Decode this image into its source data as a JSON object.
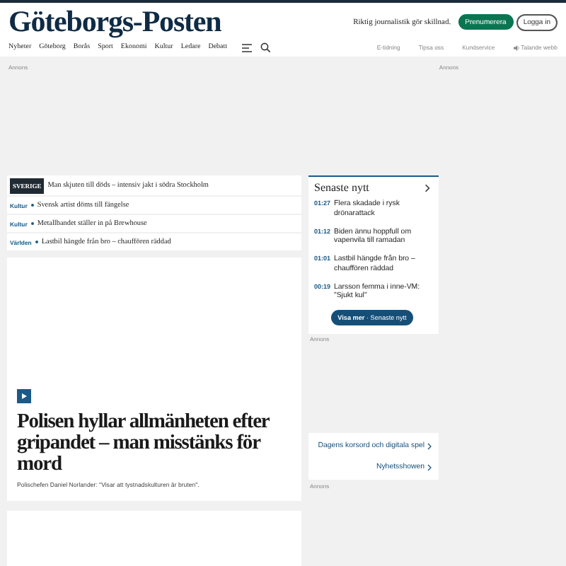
{
  "header": {
    "logo": "Göteborgs-Posten",
    "tagline": "Riktig journalistik gör skillnad.",
    "subscribe_button": "Prenumerera",
    "login_button": "Logga in",
    "nav": [
      "Nyheter",
      "Göteborg",
      "Borås",
      "Sport",
      "Ekonomi",
      "Kultur",
      "Ledare",
      "Debatt"
    ],
    "utility_links": [
      {
        "label": "E-tidning",
        "kind": "link"
      },
      {
        "label": "Tipsa oss",
        "kind": "link"
      },
      {
        "label": "Kundservice",
        "kind": "link"
      },
      {
        "label": "Talande webb",
        "kind": "audio"
      }
    ]
  },
  "top_ad_labels": [
    "Annons",
    "Annons"
  ],
  "teasers": [
    {
      "kind": "badge",
      "category": "SVERIGE",
      "title": "Man skjuten till döds – intensiv jakt i södra Stockholm"
    },
    {
      "kind": "category",
      "category": "Kultur",
      "title": "Svensk artist döms till fängelse"
    },
    {
      "kind": "category",
      "category": "Kultur",
      "title": "Metallbandet ställer in på Brewhouse"
    },
    {
      "kind": "category",
      "category": "Världen",
      "title": "Lastbil hängde från bro – chauffören räddad"
    }
  ],
  "main_article": {
    "kind": "video",
    "headline": "Polisen hyllar allmänheten efter gripandet – man misstänks för mord",
    "subtitle": "Polischefen Daniel Norlander: \"Visar att tystnadskulturen är bruten\"."
  },
  "latest": {
    "title": "Senaste nytt",
    "items": [
      {
        "time": "01:27",
        "text": "Flera skadade i rysk drönarattack"
      },
      {
        "time": "01:12",
        "text": "Biden ännu hoppfull om vapenvila till ramadan"
      },
      {
        "time": "01:01",
        "text": "Lastbil hängde från bro – chauffören räddad"
      },
      {
        "time": "00:19",
        "text": "Larsson femma i inne-VM: \"Sjukt kul\""
      }
    ],
    "button": "**Visa mer** · Senaste nytt"
  },
  "right_ad_labels": [
    "Annons",
    "Annons"
  ],
  "links": [
    "Dagens korsord och digitala spel",
    "Nyhetsshowen"
  ]
}
